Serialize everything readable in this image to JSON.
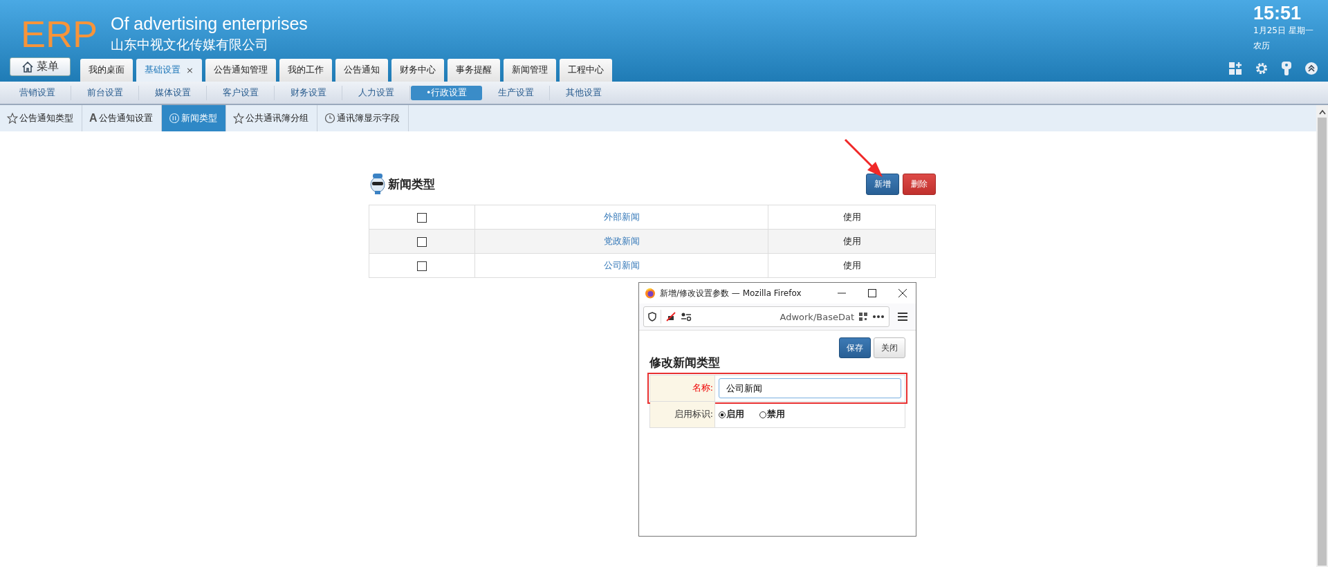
{
  "header": {
    "logo": "ERP",
    "title": "Of advertising enterprises",
    "company": "山东中视文化传媒有限公司",
    "menu_button": "菜单",
    "clock": {
      "time": "15:51",
      "date": "1月25日 星期一",
      "lunar": "农历"
    }
  },
  "main_tabs": [
    {
      "label": "我的桌面",
      "selected": false,
      "closable": false
    },
    {
      "label": "基础设置",
      "selected": true,
      "closable": true,
      "close": "×"
    },
    {
      "label": "公告通知管理",
      "selected": false,
      "closable": false
    },
    {
      "label": "我的工作",
      "selected": false,
      "closable": false
    },
    {
      "label": "公告通知",
      "selected": false,
      "closable": false
    },
    {
      "label": "财务中心",
      "selected": false,
      "closable": false
    },
    {
      "label": "事务提醒",
      "selected": false,
      "closable": false
    },
    {
      "label": "新闻管理",
      "selected": false,
      "closable": false
    },
    {
      "label": "工程中心",
      "selected": false,
      "closable": false
    }
  ],
  "sub_nav": [
    {
      "label": "营销设置",
      "selected": false
    },
    {
      "label": "前台设置",
      "selected": false
    },
    {
      "label": "媒体设置",
      "selected": false
    },
    {
      "label": "客户设置",
      "selected": false
    },
    {
      "label": "财务设置",
      "selected": false
    },
    {
      "label": "人力设置",
      "selected": false
    },
    {
      "label": "•行政设置",
      "selected": true
    },
    {
      "label": "生产设置",
      "selected": false
    },
    {
      "label": "其他设置",
      "selected": false
    }
  ],
  "page_tabs": [
    {
      "label": "公告通知类型",
      "selected": false,
      "kind": "star"
    },
    {
      "label": "公告通知设置",
      "selected": false,
      "kind": "letter",
      "glyph": "A"
    },
    {
      "label": "新闻类型",
      "selected": true,
      "kind": "pause"
    },
    {
      "label": "公共通讯簿分组",
      "selected": false,
      "kind": "star"
    },
    {
      "label": "通讯簿显示字段",
      "selected": false,
      "kind": "clock"
    }
  ],
  "content": {
    "title": "新闻类型",
    "buttons": [
      {
        "label": "新增",
        "kind": "primary"
      },
      {
        "label": "删除",
        "kind": "danger"
      }
    ],
    "rows": [
      {
        "checked": false,
        "name": "外部新闻",
        "status": "使用"
      },
      {
        "checked": false,
        "name": "党政新闻",
        "status": "使用"
      },
      {
        "checked": false,
        "name": "公司新闻",
        "status": "使用"
      }
    ]
  },
  "dialog": {
    "title": "新增/修改设置参数 — Mozilla Firefox",
    "url": "Adwork/BaseDat",
    "heading": "修改新闻类型",
    "buttons": [
      {
        "label": "保存",
        "kind": "primary"
      },
      {
        "label": "关闭",
        "kind": "default"
      }
    ],
    "fields": [
      {
        "kind": "text",
        "label": "名称:",
        "value": "公司新闻",
        "required": true,
        "highlighted": true
      },
      {
        "kind": "radio",
        "label": "启用标识:",
        "required": false,
        "options": [
          {
            "label": "启用",
            "selected": true
          },
          {
            "label": "禁用",
            "selected": false
          }
        ]
      }
    ]
  }
}
